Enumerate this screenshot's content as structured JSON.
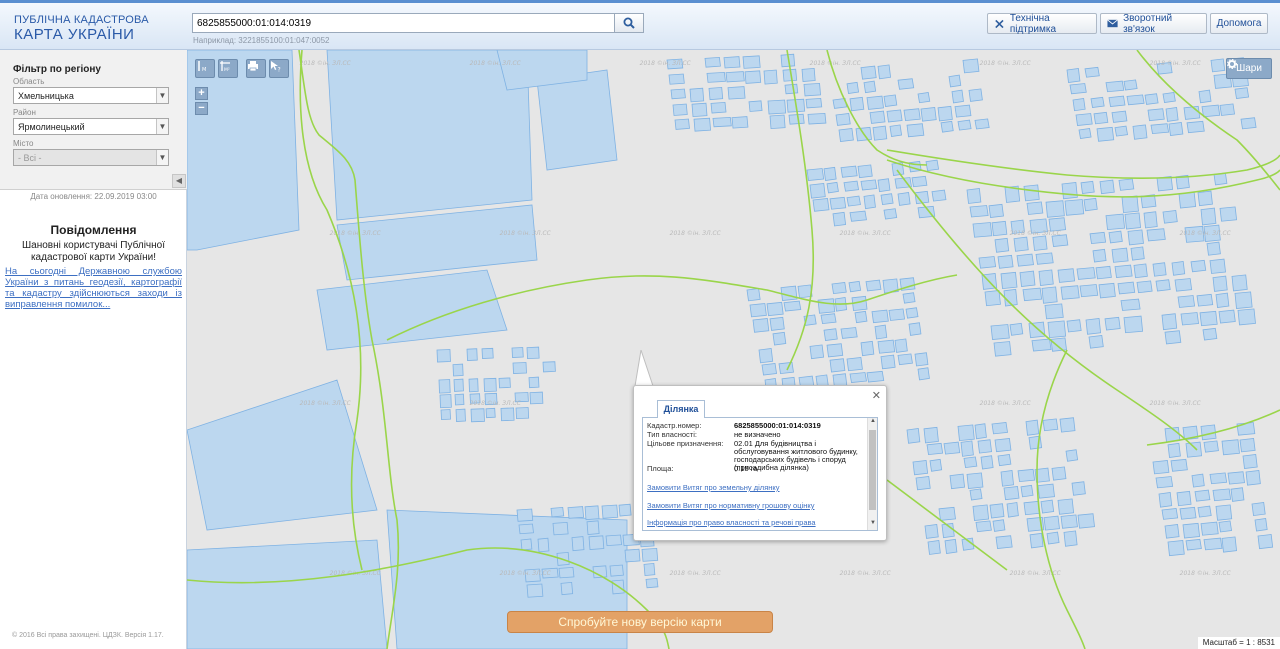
{
  "header": {
    "logo_line1": "ПУБЛІЧНА КАДАСТРОВА",
    "logo_line2": "КАРТА УКРАЇНИ",
    "search_value": "6825855000:01:014:0319",
    "search_hint": "Наприклад: 3221855100:01:047:0052",
    "buttons": {
      "support": "Технічна підтримка",
      "feedback": "Зворотний зв'язок",
      "help": "Допомога"
    }
  },
  "sidebar": {
    "filter_title": "Фільтр по регіону",
    "oblast_label": "Область",
    "oblast_value": "Хмельницька",
    "raion_label": "Район",
    "raion_value": "Ярмолинецький",
    "misto_label": "Місто",
    "misto_value": "- Всі -",
    "update_date": "Дата оновлення: 22.09.2019 03:00",
    "notice_title": "Повідомлення",
    "notice_text": "Шановні користувачі Публічної кадастрової карти України!",
    "notice_link": "На сьогодні Державною службою України з питань геодезії, картографії та кадастру здійснюються заходи із виправлення помилок...",
    "copyright": "© 2016 Всі права захищені. ЦДЗК. Версія 1.17."
  },
  "map": {
    "layers_label": "Шари",
    "promo": "Спробуйте нову версію карти",
    "scale": "Масштаб = 1 : 8531",
    "watermark": "2018 ©ін. ЗЛ.СС",
    "popup": {
      "tab": "Ділянка",
      "fields": [
        {
          "k": "Кадастр.номер:",
          "v": "6825855000:01:014:0319"
        },
        {
          "k": "Тип власності:",
          "v": "не визначено"
        },
        {
          "k": "Цільове призначення:",
          "v": "02.01 Для будівництва і обслуговування житлового будинку, господарських будівель і споруд (присадибна ділянка)"
        },
        {
          "k": "Площа:",
          "v": "0.15 га"
        }
      ],
      "links": [
        "Замовити Витяг про земельну ділянку",
        "Замовити Витяг про нормативну грошову оцінку",
        "Інформація про право власності та речові права"
      ]
    }
  },
  "colors": {
    "parcel_fill": "#bcd7ef",
    "parcel_stroke": "#7fb2e3",
    "boundary": "#9ad54a",
    "map_bg": "#e6e6e6",
    "promo": "#e3a267"
  }
}
